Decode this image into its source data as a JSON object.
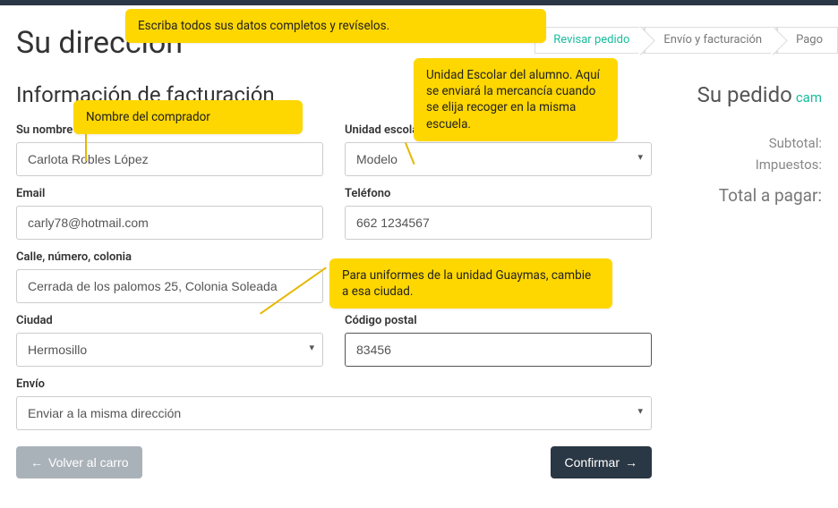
{
  "header": {
    "title": "Su dirección"
  },
  "breadcrumb": {
    "step1": "Revisar pedido",
    "step2": "Envío y facturación",
    "step3": "Pago"
  },
  "section_title": "Información de facturación",
  "labels": {
    "name": "Su nombre",
    "school": "Unidad escolar",
    "email": "Email",
    "phone": "Teléfono",
    "address": "Calle, número, colonia",
    "city": "Ciudad",
    "postal": "Código postal",
    "shipping": "Envío"
  },
  "values": {
    "name": "Carlota Robles López",
    "school": "Modelo",
    "email": "carly78@hotmail.com",
    "phone": "662 1234567",
    "address": "Cerrada de los palomos 25, Colonia Soleada",
    "city": "Hermosillo",
    "postal": "83456",
    "shipping": "Enviar a la misma dirección"
  },
  "sidebar": {
    "title": "Su pedido",
    "change": "cam",
    "subtotal_label": "Subtotal:",
    "tax_label": "Impuestos:",
    "total_label": "Total a pagar:"
  },
  "buttons": {
    "back": "Volver al carro",
    "confirm": "Confirmar"
  },
  "callouts": {
    "top": "Escriba todos sus datos completos y revíselos.",
    "name": "Nombre del comprador",
    "school": "Unidad Escolar del alumno. Aquí se enviará la mercancía cuando se elija recoger en la misma escuela.",
    "city": "Para uniformes de la unidad Guaymas, cambie a esa ciudad."
  }
}
